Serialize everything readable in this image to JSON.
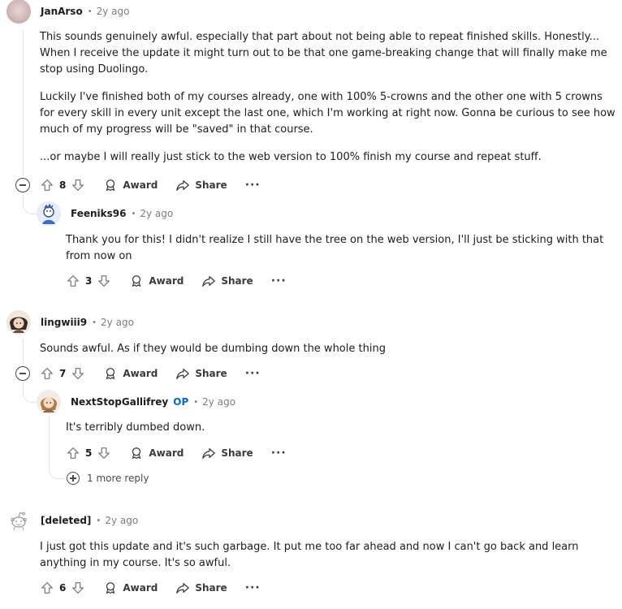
{
  "comments": [
    {
      "author": "JanArso",
      "time": "2y ago",
      "paragraphs": [
        "This sounds genuinely awful. especially that part about not being able to repeat finished skills. Honestly... When I receive the update it might turn out to be that one game-breaking change that will finally make me stop using Duolingo.",
        "Luckily I've finished both of my courses already, one with 100% 5-crowns and the other one with 5 crowns for every skill in every unit except the last one, which I'm working at right now. Gonna be curious to see how much of my progress will be \"saved\" in that course.",
        "...or maybe I will really just stick to the web version to 100% finish my course and repeat stuff."
      ],
      "votes": "8"
    },
    {
      "author": "Feeniks96",
      "time": "2y ago",
      "paragraphs": [
        "Thank you for this! I didn't realize I still have the tree on the web version, I'll just be sticking with that from now on"
      ],
      "votes": "3"
    },
    {
      "author": "lingwiii9",
      "time": "2y ago",
      "paragraphs": [
        "Sounds awful. As if they would be dumbing down the whole thing"
      ],
      "votes": "7"
    },
    {
      "author": "NextStopGallifrey",
      "op_label": "OP",
      "time": "2y ago",
      "paragraphs": [
        "It's terribly dumbed down."
      ],
      "votes": "5"
    },
    {
      "author": "[deleted]",
      "time": "2y ago",
      "paragraphs": [
        "I just got this update and it's such garbage. It put me too far ahead and now I can't go back and learn anything in my course. It's so awful."
      ],
      "votes": "6"
    }
  ],
  "labels": {
    "dot": "•",
    "award": "Award",
    "share": "Share",
    "more": "···",
    "more_replies": "1 more reply"
  },
  "icons": [
    "upvote-icon",
    "downvote-icon",
    "award-icon",
    "share-icon",
    "more-icon",
    "collapse-icon",
    "expand-icon"
  ],
  "colors": {
    "text": "#1c1c1c",
    "meta": "#7c7c7c",
    "op": "#0a66c2",
    "thread": "#e2e4e7"
  }
}
